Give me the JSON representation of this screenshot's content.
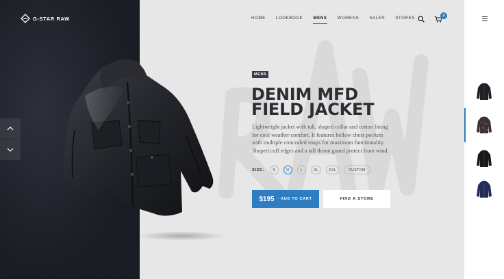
{
  "brand": {
    "name": "G-STAR RAW"
  },
  "nav": {
    "items": [
      {
        "label": "HOME",
        "active": false
      },
      {
        "label": "LOOKBOOK",
        "active": false
      },
      {
        "label": "MENS",
        "active": true
      },
      {
        "label": "WOMENS",
        "active": false
      },
      {
        "label": "SALES",
        "active": false
      },
      {
        "label": "STORES",
        "active": false
      }
    ],
    "search_icon": "search-icon",
    "cart_icon": "cart-icon",
    "cart_count": "2",
    "menu_icon": "hamburger-menu-icon"
  },
  "product": {
    "category": "MENS",
    "title_line1": "DENIM MFD",
    "title_line2": "FIELD JACKET",
    "description": "Lightweight jacket with tall, shaped collar and cotton lining for cool weather comfort. It features bellow chest pockets with multiple concealed snaps for maximum functionality. Shaped cuff edges and a tall throat guard protect from wind.",
    "size_label": "SIZE:",
    "sizes": [
      "S",
      "M",
      "L",
      "XL",
      "XXL",
      "CUSTOM"
    ],
    "selected_size": "M",
    "price": "$195",
    "add_to_cart_label": "· ADD TO CART",
    "find_store_label": "FIND A STORE"
  },
  "slider": {
    "up_icon": "chevron-up-icon",
    "down_icon": "chevron-down-icon"
  },
  "thumbnails": {
    "count_selected_index": 1,
    "items": [
      "black-jacket",
      "patterned-jacket",
      "black-jacket",
      "navy-jacket"
    ]
  },
  "colors": {
    "accent": "#2e7cc1",
    "dark_panel": "#1a1c24",
    "title": "#2b2d33"
  }
}
